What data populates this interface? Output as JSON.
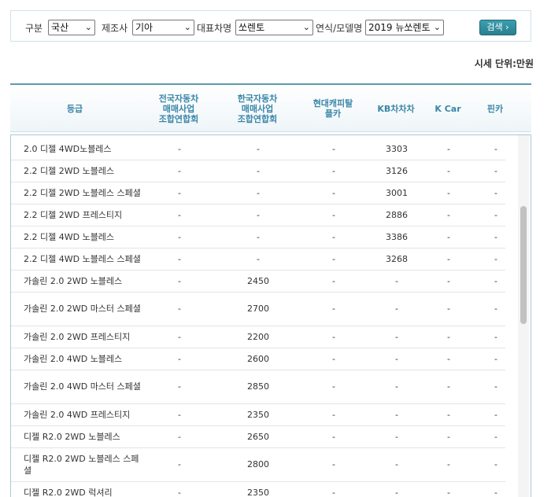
{
  "filters": {
    "type_label": "구분",
    "type_value": "국산",
    "maker_label": "제조사",
    "maker_value": "기아",
    "model_label": "대표차명",
    "model_value": "쏘렌토",
    "year_label": "연식/모델명",
    "year_value": "2019 뉴쏘렌토",
    "search_label": "검색 ›"
  },
  "unit_label": "시세 단위:만원",
  "columns": [
    "등급",
    "전국자동차\n매매사업\n조합연합회",
    "한국자동차\n매매사업\n조합연합회",
    "현대캐피탈\n플카",
    "KB차차차",
    "K Car",
    "핀카"
  ],
  "rows": [
    {
      "grade": "2.0 디젤 4WD노블레스",
      "v1": "-",
      "v2": "-",
      "v3": "-",
      "v4": "3303",
      "v5": "-",
      "v6": "-"
    },
    {
      "grade": "2.2 디젤 2WD 노블레스",
      "v1": "-",
      "v2": "-",
      "v3": "-",
      "v4": "3126",
      "v5": "-",
      "v6": "-"
    },
    {
      "grade": "2.2 디젤 2WD 노블레스 스페셜",
      "v1": "-",
      "v2": "-",
      "v3": "-",
      "v4": "3001",
      "v5": "-",
      "v6": "-"
    },
    {
      "grade": "2.2 디젤 2WD 프레스티지",
      "v1": "-",
      "v2": "-",
      "v3": "-",
      "v4": "2886",
      "v5": "-",
      "v6": "-"
    },
    {
      "grade": "2.2 디젤 4WD 노블레스",
      "v1": "-",
      "v2": "-",
      "v3": "-",
      "v4": "3386",
      "v5": "-",
      "v6": "-"
    },
    {
      "grade": "2.2 디젤 4WD 노블레스 스페셜",
      "v1": "-",
      "v2": "-",
      "v3": "-",
      "v4": "3268",
      "v5": "-",
      "v6": "-"
    },
    {
      "grade": "가솔린 2.0 2WD 노블레스",
      "v1": "-",
      "v2": "2450",
      "v3": "-",
      "v4": "-",
      "v5": "-",
      "v6": "-"
    },
    {
      "grade": "가솔린 2.0 2WD 마스터 스페셜",
      "v1": "-",
      "v2": "2700",
      "v3": "-",
      "v4": "-",
      "v5": "-",
      "v6": "-"
    },
    {
      "grade": "가솔린 2.0 2WD 프레스티지",
      "v1": "-",
      "v2": "2200",
      "v3": "-",
      "v4": "-",
      "v5": "-",
      "v6": "-"
    },
    {
      "grade": "가솔린 2.0 4WD 노블레스",
      "v1": "-",
      "v2": "2600",
      "v3": "-",
      "v4": "-",
      "v5": "-",
      "v6": "-"
    },
    {
      "grade": "가솔린 2.0 4WD 마스터 스페셜",
      "v1": "-",
      "v2": "2850",
      "v3": "-",
      "v4": "-",
      "v5": "-",
      "v6": "-"
    },
    {
      "grade": "가솔린 2.0 4WD 프레스티지",
      "v1": "-",
      "v2": "2350",
      "v3": "-",
      "v4": "-",
      "v5": "-",
      "v6": "-"
    },
    {
      "grade": "디젤 R2.0 2WD 노블레스",
      "v1": "-",
      "v2": "2650",
      "v3": "-",
      "v4": "-",
      "v5": "-",
      "v6": "-"
    },
    {
      "grade": "디젤 R2.0 2WD 노블레스 스페셜",
      "v1": "-",
      "v2": "2800",
      "v3": "-",
      "v4": "-",
      "v5": "-",
      "v6": "-"
    },
    {
      "grade": "디젤 R2.0 2WD 럭셔리",
      "v1": "-",
      "v2": "2350",
      "v3": "-",
      "v4": "-",
      "v5": "-",
      "v6": "-"
    }
  ]
}
